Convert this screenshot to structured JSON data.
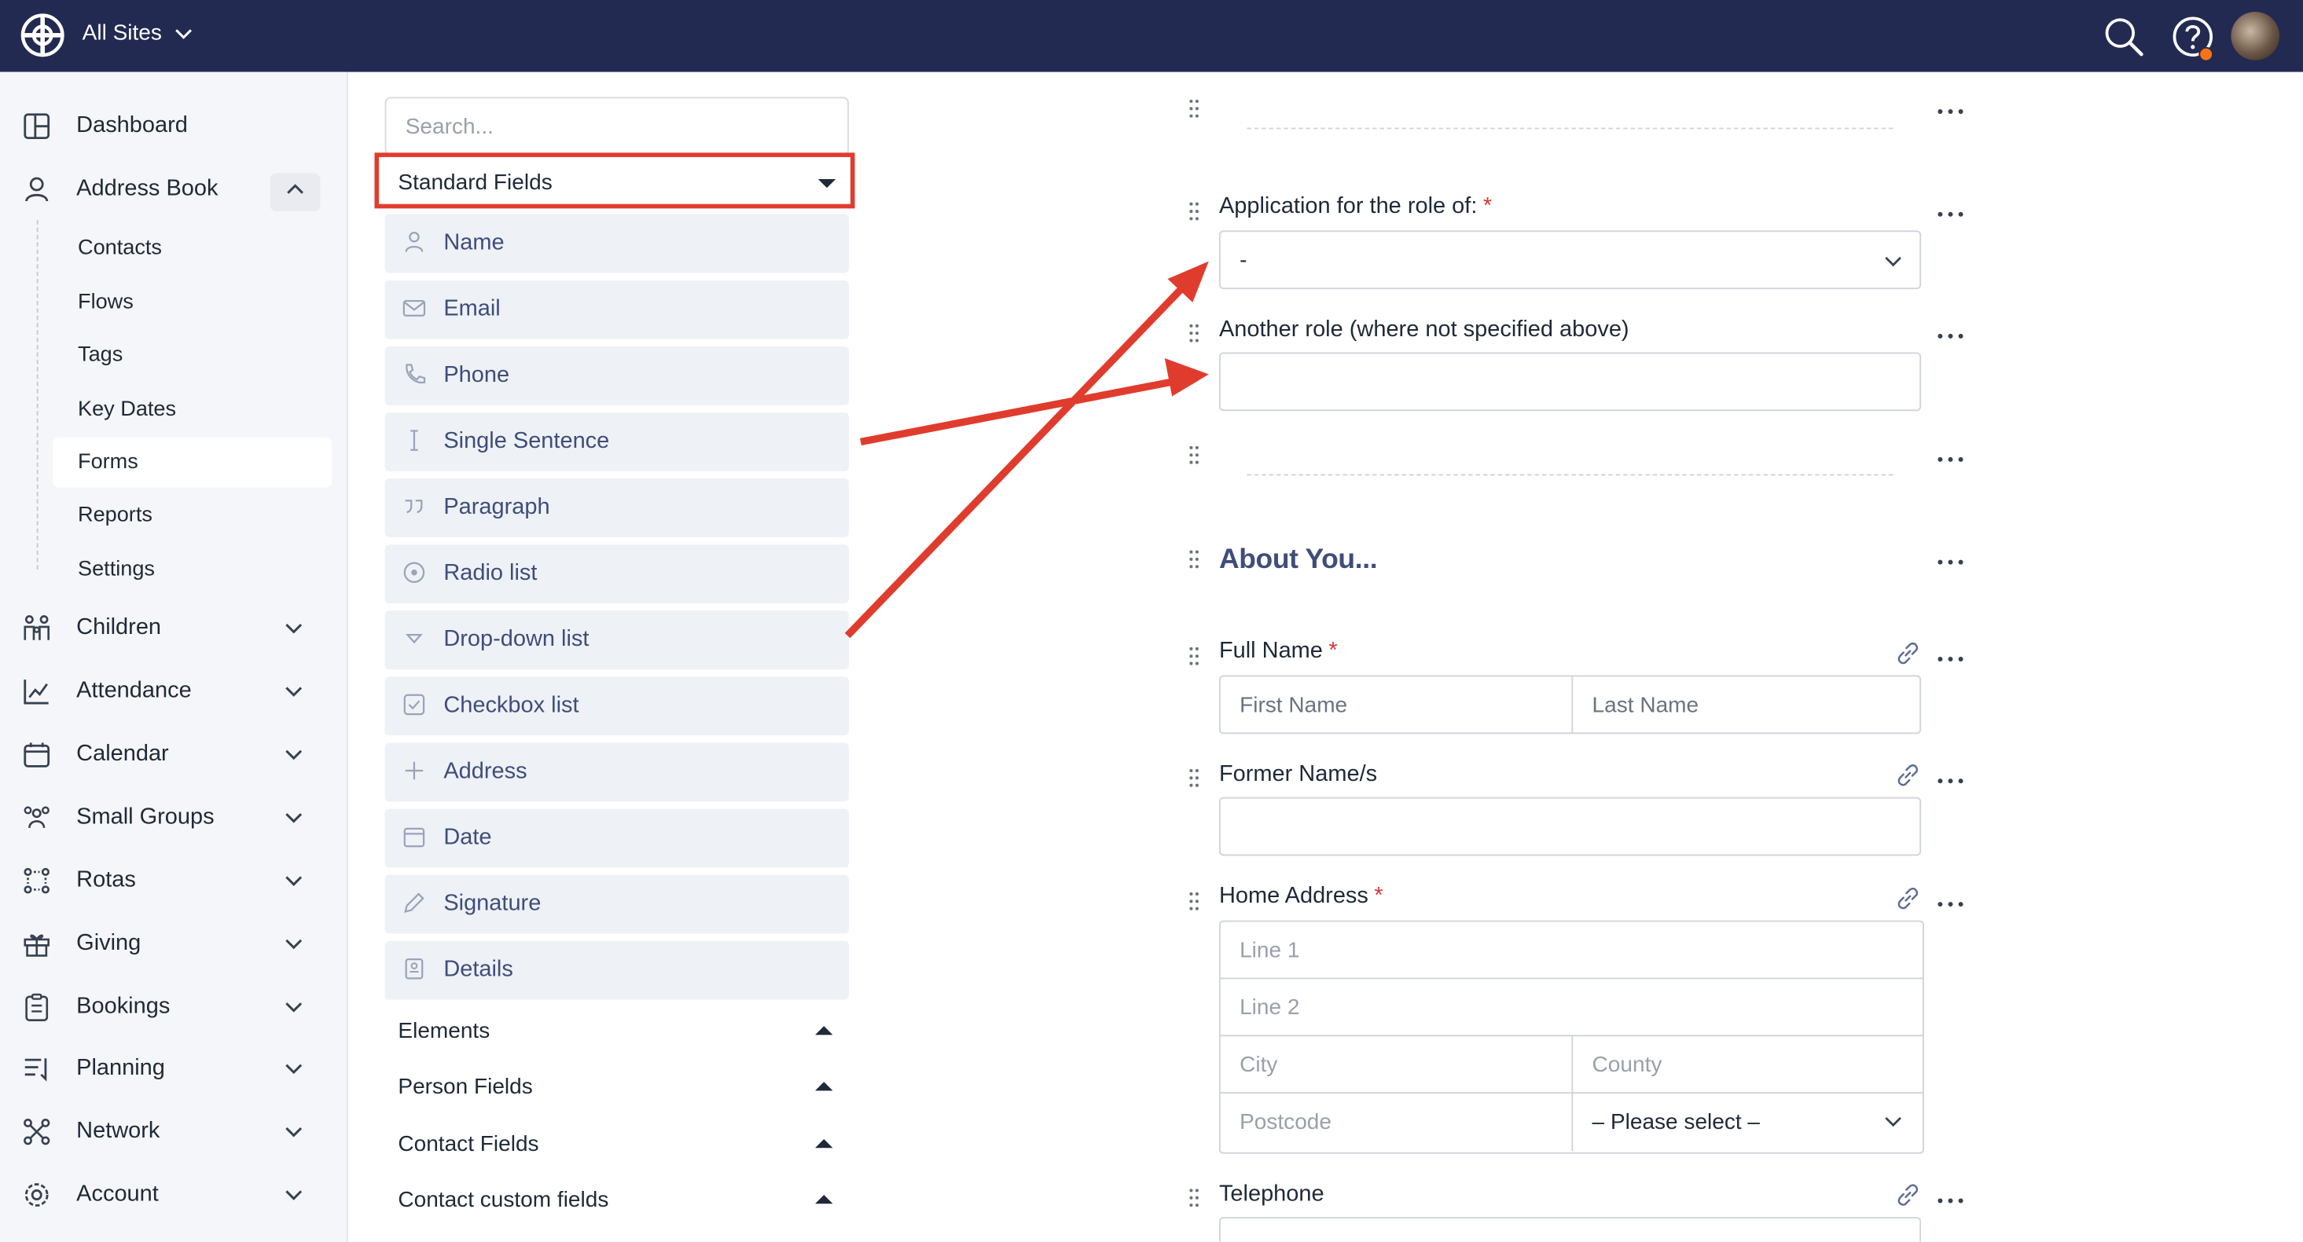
{
  "colors": {
    "topbar": "#232a52",
    "accent": "#3f4d7a",
    "highlight": "#e03c2e",
    "required": "#d93636"
  },
  "topbar": {
    "site_switch": "All Sites",
    "icons": [
      "globe-logo-icon",
      "search-icon",
      "help-icon",
      "avatar"
    ]
  },
  "sidebar": {
    "items": [
      {
        "label": "Dashboard",
        "icon": "dashboard-icon"
      },
      {
        "label": "Address Book",
        "icon": "person-icon",
        "expanded": true
      },
      {
        "label": "Children",
        "icon": "children-icon"
      },
      {
        "label": "Attendance",
        "icon": "chart-icon"
      },
      {
        "label": "Calendar",
        "icon": "calendar-icon"
      },
      {
        "label": "Small Groups",
        "icon": "group-icon"
      },
      {
        "label": "Rotas",
        "icon": "rotas-icon"
      },
      {
        "label": "Giving",
        "icon": "gift-icon"
      },
      {
        "label": "Bookings",
        "icon": "clipboard-icon"
      },
      {
        "label": "Planning",
        "icon": "planning-icon"
      },
      {
        "label": "Network",
        "icon": "network-icon"
      },
      {
        "label": "Account",
        "icon": "gear-icon"
      }
    ],
    "sub_items": [
      "Contacts",
      "Flows",
      "Tags",
      "Key Dates",
      "Forms",
      "Reports",
      "Settings"
    ],
    "active_sub_item": "Forms"
  },
  "palette": {
    "search_placeholder": "Search...",
    "category_select": "Standard Fields",
    "fields": [
      {
        "label": "Name",
        "icon": "person-icon"
      },
      {
        "label": "Email",
        "icon": "mail-icon"
      },
      {
        "label": "Phone",
        "icon": "phone-icon"
      },
      {
        "label": "Single Sentence",
        "icon": "text-cursor-icon"
      },
      {
        "label": "Paragraph",
        "icon": "quote-icon"
      },
      {
        "label": "Radio list",
        "icon": "radio-icon"
      },
      {
        "label": "Drop-down list",
        "icon": "dropdown-icon"
      },
      {
        "label": "Checkbox list",
        "icon": "checkbox-icon"
      },
      {
        "label": "Address",
        "icon": "plus-icon"
      },
      {
        "label": "Date",
        "icon": "calendar-icon"
      },
      {
        "label": "Signature",
        "icon": "pencil-icon"
      },
      {
        "label": "Details",
        "icon": "details-icon"
      }
    ],
    "groups": [
      "Elements",
      "Person Fields",
      "Contact Fields",
      "Contact custom fields"
    ]
  },
  "form": {
    "role_label": "Application for the role of:",
    "role_value": "-",
    "another_role_label": "Another role (where not specified above)",
    "section_title": "About You...",
    "full_name_label": "Full Name",
    "first_name_placeholder": "First Name",
    "last_name_placeholder": "Last Name",
    "former_name_label": "Former Name/s",
    "home_address_label": "Home Address",
    "line1_placeholder": "Line 1",
    "line2_placeholder": "Line 2",
    "city_placeholder": "City",
    "county_placeholder": "County",
    "postcode_placeholder": "Postcode",
    "country_select": "– Please select –",
    "telephone_label": "Telephone",
    "required_mark": "*"
  }
}
